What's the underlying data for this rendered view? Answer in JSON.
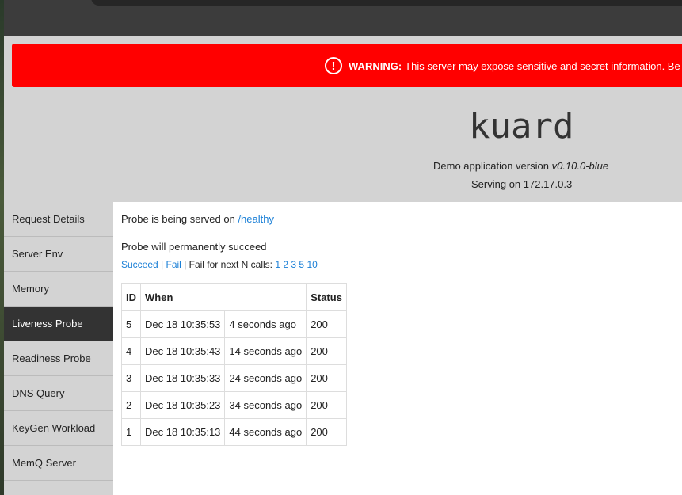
{
  "browser": {
    "url_fragment": "…)"
  },
  "warning": {
    "label": "WARNING:",
    "text": "This server may expose sensitive and secret information. Be"
  },
  "header": {
    "logo": "kuard",
    "version_prefix": "Demo application version ",
    "version": "v0.10.0-blue",
    "serving": "Serving on 172.17.0.3"
  },
  "sidebar": {
    "items": [
      {
        "label": "Request Details"
      },
      {
        "label": "Server Env"
      },
      {
        "label": "Memory"
      },
      {
        "label": "Liveness Probe",
        "active": true
      },
      {
        "label": "Readiness Probe"
      },
      {
        "label": "DNS Query"
      },
      {
        "label": "KeyGen Workload"
      },
      {
        "label": "MemQ Server"
      }
    ]
  },
  "content": {
    "served_prefix": "Probe is being served on ",
    "served_path": "/healthy",
    "status": "Probe will permanently succeed",
    "succeed": "Succeed",
    "sep1": " | ",
    "fail": "Fail",
    "fail_next": " | Fail for next N calls: ",
    "n_values": [
      "1",
      "2",
      "3",
      "5",
      "10"
    ]
  },
  "table": {
    "headers": [
      "ID",
      "When",
      "Status"
    ],
    "rows": [
      {
        "id": "5",
        "time": "Dec 18 10:35:53",
        "ago": "4 seconds ago",
        "status": "200"
      },
      {
        "id": "4",
        "time": "Dec 18 10:35:43",
        "ago": "14 seconds ago",
        "status": "200"
      },
      {
        "id": "3",
        "time": "Dec 18 10:35:33",
        "ago": "24 seconds ago",
        "status": "200"
      },
      {
        "id": "2",
        "time": "Dec 18 10:35:23",
        "ago": "34 seconds ago",
        "status": "200"
      },
      {
        "id": "1",
        "time": "Dec 18 10:35:13",
        "ago": "44 seconds ago",
        "status": "200"
      }
    ]
  }
}
